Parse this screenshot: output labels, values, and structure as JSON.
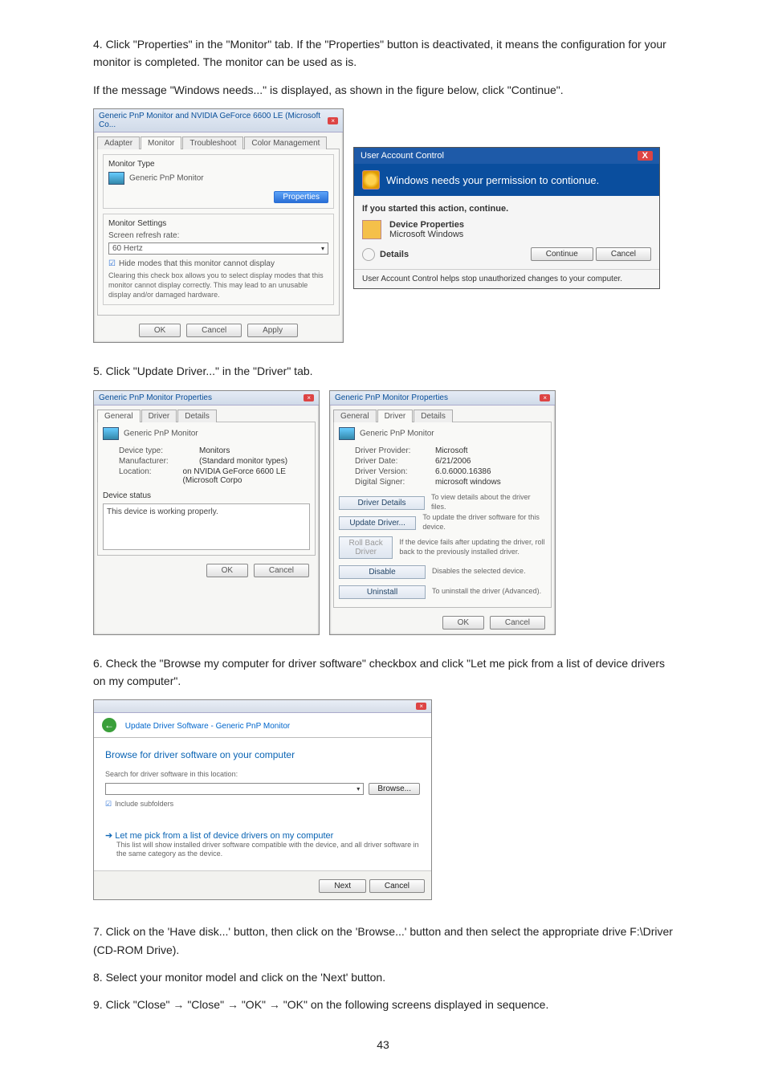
{
  "step4": {
    "text_a": "4. Click \"Properties\" in the \"Monitor\" tab. If the \"Properties\" button is deactivated, it means the configuration for your monitor is completed. The monitor can be used as is.",
    "text_b": "If the message \"Windows needs...\" is displayed, as shown in the figure below, click \"Continue\"."
  },
  "dlg1": {
    "title": "Generic PnP Monitor and NVIDIA GeForce 6600 LE (Microsoft Co...",
    "tabs": [
      "Adapter",
      "Monitor",
      "Troubleshoot",
      "Color Management"
    ],
    "monitor_type_label": "Monitor Type",
    "monitor_name": "Generic PnP Monitor",
    "properties_btn": "Properties",
    "settings_label": "Monitor Settings",
    "refresh_label": "Screen refresh rate:",
    "refresh_value": "60 Hertz",
    "hide_modes": "Hide modes that this monitor cannot display",
    "hide_desc": "Clearing this check box allows you to select display modes that this monitor cannot display correctly. This may lead to an unusable display and/or damaged hardware.",
    "ok": "OK",
    "cancel": "Cancel",
    "apply": "Apply"
  },
  "uac": {
    "title": "User Account Control",
    "banner": "Windows needs your permission to contionue.",
    "started": "If you started this action, continue.",
    "device": "Device Properties",
    "ms": "Microsoft Windows",
    "details": "Details",
    "continue": "Continue",
    "cancel": "Cancel",
    "foot": "User Account Control helps stop unauthorized changes to your computer."
  },
  "step5": "5. Click \"Update Driver...\" in the \"Driver\" tab.",
  "dlg2a": {
    "title": "Generic PnP Monitor Properties",
    "tabs": [
      "General",
      "Driver",
      "Details"
    ],
    "name": "Generic PnP Monitor",
    "kv": [
      {
        "k": "Device type:",
        "v": "Monitors"
      },
      {
        "k": "Manufacturer:",
        "v": "(Standard monitor types)"
      },
      {
        "k": "Location:",
        "v": "on NVIDIA GeForce 6600 LE (Microsoft Corpo"
      }
    ],
    "status_label": "Device status",
    "status": "This device is working properly.",
    "ok": "OK",
    "cancel": "Cancel"
  },
  "dlg2b": {
    "title": "Generic PnP Monitor Properties",
    "tabs": [
      "General",
      "Driver",
      "Details"
    ],
    "name": "Generic PnP Monitor",
    "kv": [
      {
        "k": "Driver Provider:",
        "v": "Microsoft"
      },
      {
        "k": "Driver Date:",
        "v": "6/21/2006"
      },
      {
        "k": "Driver Version:",
        "v": "6.0.6000.16386"
      },
      {
        "k": "Digital Signer:",
        "v": "microsoft windows"
      }
    ],
    "btns": [
      {
        "label": "Driver Details",
        "desc": "To view details about the driver files."
      },
      {
        "label": "Update Driver...",
        "desc": "To update the driver software for this device."
      },
      {
        "label": "Roll Back Driver",
        "desc": "If the device fails after updating the driver, roll back to the previously installed driver."
      },
      {
        "label": "Disable",
        "desc": "Disables the selected device."
      },
      {
        "label": "Uninstall",
        "desc": "To uninstall the driver (Advanced)."
      }
    ],
    "ok": "OK",
    "cancel": "Cancel"
  },
  "step6": "6. Check the \"Browse my computer for driver software\" checkbox and click \"Let me pick from a list of device drivers on my computer\".",
  "wizard": {
    "crumb": "Update Driver Software - Generic PnP Monitor",
    "heading": "Browse for driver software on your computer",
    "search_label": "Search for driver software in this location:",
    "path": "",
    "browse": "Browse...",
    "include": "Include subfolders",
    "pick_head": "Let me pick from a list of device drivers on my computer",
    "pick_desc": "This list will show installed driver software compatible with the device, and all driver software in the same category as the device.",
    "next": "Next",
    "cancel": "Cancel"
  },
  "step7": "7. Click on the 'Have disk...' button, then click on the 'Browse...' button and then select the appropriate drive F:\\Driver (CD-ROM Drive).",
  "step8": "8. Select your monitor model and click on the 'Next' button.",
  "step9_a": "9. Click \"Close\" ",
  "step9_b": " \"Close\" ",
  "step9_c": " \"OK\" ",
  "step9_d": " \"OK\" on the following screens displayed in sequence.",
  "arrow": "→",
  "page_number": "43"
}
